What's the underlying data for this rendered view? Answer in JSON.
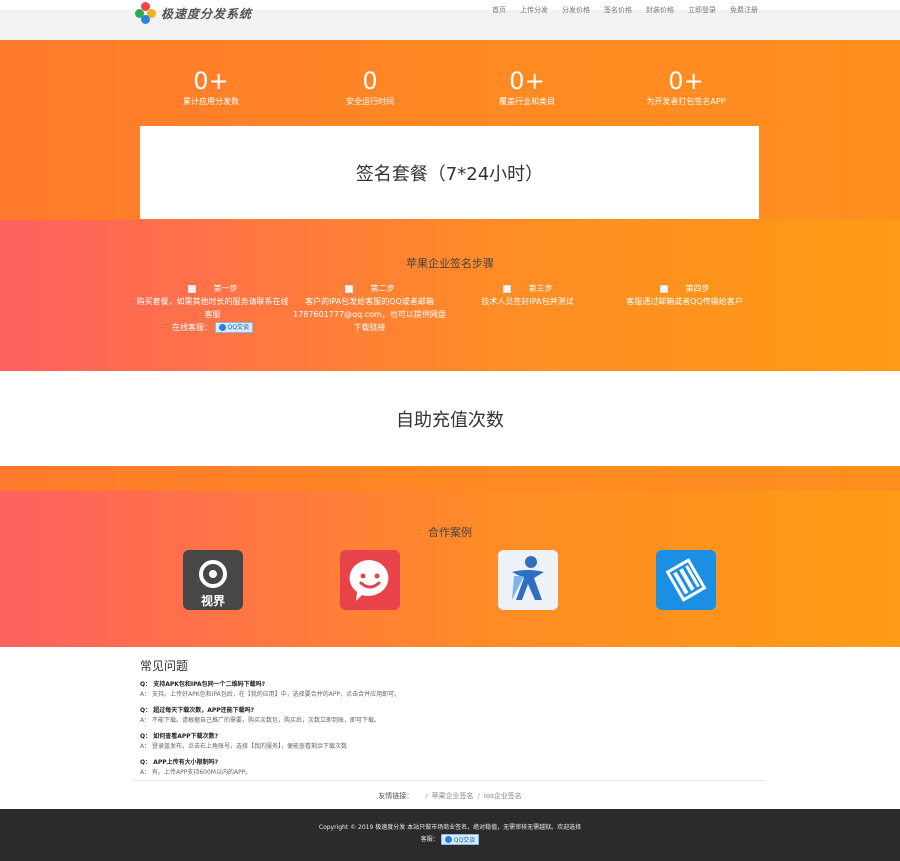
{
  "header": {
    "logo_text": "极速度分发系统",
    "nav": [
      "首页",
      "上传分发",
      "分发价格",
      "签名价格",
      "封装价格",
      "立即登录",
      "免费注册"
    ]
  },
  "stats": [
    {
      "num": "0+",
      "label": "累计应用分发数"
    },
    {
      "num": "0",
      "label": "安全运行时间"
    },
    {
      "num": "0+",
      "label": "覆盖行业和类目"
    },
    {
      "num": "0+",
      "label": "为开发者打包签名APP"
    }
  ],
  "sign_package": {
    "title": "签名套餐（7*24小时）"
  },
  "steps": {
    "title": "苹果企业签名步骤",
    "items": [
      {
        "head": "第一步",
        "text": "购买套餐，如需其他时长的服务请联系在线客服",
        "extra": "在线客服：",
        "button": "QQ交谈"
      },
      {
        "head": "第二步",
        "text": "客户的IPA包发给客服的QQ或者邮箱1787601777@qq.com，也可以提供网盘下载链接"
      },
      {
        "head": "第三步",
        "text": "技术人员签好IPA包并测试"
      },
      {
        "head": "第四步",
        "text": "客服通过邮箱或者QQ传输给客户"
      }
    ]
  },
  "recharge": {
    "title": "自助充值次数"
  },
  "cases": {
    "title": "合作案例",
    "items": [
      {
        "name": "视界",
        "icon": "shijie-app-icon",
        "color": "#474747"
      },
      {
        "name": "smile",
        "icon": "smile-app-icon",
        "color": "#e8434a"
      },
      {
        "name": "sport",
        "icon": "runner-app-icon",
        "color": "#f1f3f6"
      },
      {
        "name": "book",
        "icon": "book-app-icon",
        "color": "#1a8fe3"
      }
    ]
  },
  "faq": {
    "title": "常见问题",
    "items": [
      {
        "q": "Q：  支持APK包和IPA包同一个二维码下载吗?",
        "a": "A：  支持。上传好APK包和IPA包后，在【我的应用】中，选择要合并的APP，点击合并应用即可。"
      },
      {
        "q": "Q：  超过每天下载次数，APP还能下载吗?",
        "a": "A：  不能下载。请根据自己推广的需要，购买次数包，购买后，次数立即到账，即可下载。"
      },
      {
        "q": "Q：  如何查看APP下载次数?",
        "a": "A：  登录蓝发布，点击右上角账号，选择【我的服务】，便能查看剩余下载次数"
      },
      {
        "q": "Q：  APP上传有大小限制吗?",
        "a": "A：  有。上传APP支持600M以内的APP。"
      }
    ]
  },
  "links": {
    "label": "友情链接：",
    "items": [
      "苹果企业签名",
      "ios企业签名"
    ]
  },
  "footer": {
    "line1": "Copyright © 2019 极速度分发    本站只做市场商业签名，绝对稳值，无需审核无需越狱。欢迎选择",
    "service_label": "客服：",
    "button": "QQ交谈"
  }
}
